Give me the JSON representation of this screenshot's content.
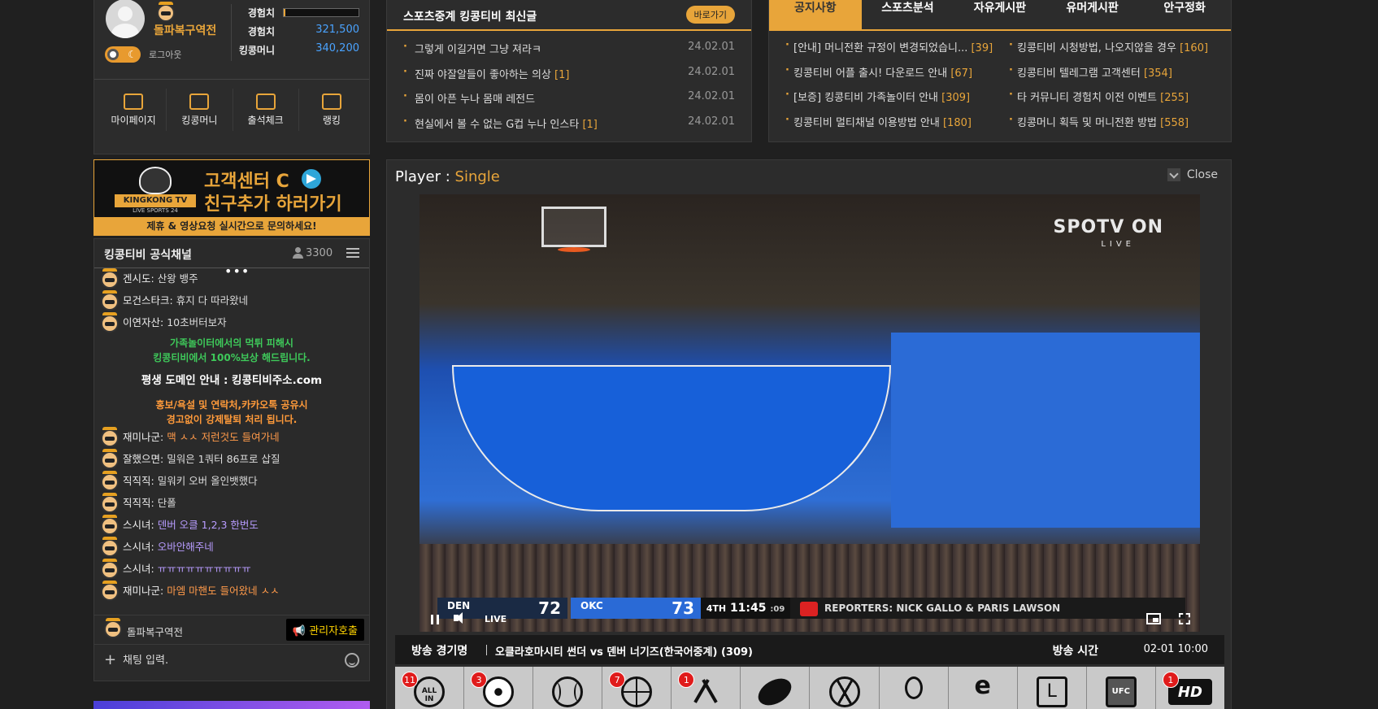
{
  "profile": {
    "username": "돌파복구역전",
    "logout_label": "로그아웃",
    "exp_bar_label": "경험치",
    "exp_bar_fraction": 0.02,
    "exp_label": "경험치",
    "exp_value": "321,500",
    "money_label": "킹콩머니",
    "money_value": "340,200",
    "theme_moon": "☾",
    "quick_menu": [
      {
        "label": "마이페이지",
        "icon": "id-card-icon"
      },
      {
        "label": "킹콩머니",
        "icon": "wallet-icon"
      },
      {
        "label": "출석체크",
        "icon": "envelope-check-icon"
      },
      {
        "label": "랭킹",
        "icon": "podium-icon"
      }
    ]
  },
  "board": {
    "title": "스포츠중계 킹콩티비 최신글",
    "goto_label": "바로가기",
    "posts": [
      {
        "title": "그렇게 이길거면 그냥 져라ㅋ",
        "count": "",
        "date": "24.02.01"
      },
      {
        "title": "진짜 야잘알들이 좋아하는 의상",
        "count": "[1]",
        "date": "24.02.01"
      },
      {
        "title": "몸이 아픈 누나 몸매 레전드",
        "count": "",
        "date": "24.02.01"
      },
      {
        "title": "현실에서 볼 수 없는 G컵 누나 인스타",
        "count": "[1]",
        "date": "24.02.01"
      }
    ]
  },
  "notice": {
    "tabs": [
      "공지사항",
      "스포츠분석",
      "자유게시판",
      "유머게시판",
      "안구정화"
    ],
    "active_tab": 0,
    "items": [
      {
        "title": "[안내] 머니전환 규정이 변경되었습니...",
        "count": "[39]"
      },
      {
        "title": "킹콩티비 시청방법, 나오지않을 경우",
        "count": "[160]"
      },
      {
        "title": "킹콩티비 어플 출시! 다운로드 안내",
        "count": "[67]"
      },
      {
        "title": "킹콩티비 텔레그램 고객센터",
        "count": "[354]"
      },
      {
        "title": "[보증] 킹콩티비 가족놀이터 안내",
        "count": "[309]"
      },
      {
        "title": "타 커뮤니티 경험치 이전 이벤트",
        "count": "[255]"
      },
      {
        "title": "킹콩티비 멀티채널 이용방법 안내",
        "count": "[180]"
      },
      {
        "title": "킹콩머니 획득 및 머니전환 방법",
        "count": "[558]"
      }
    ]
  },
  "banner": {
    "logo_name": "KINGKONG TV",
    "logo_sub": "LIVE SPORTS 24",
    "line1": "고객센터 C",
    "line2": "친구추가 하러가기",
    "strip": "제휴 & 영상요청 실시간으로 문의하세요!"
  },
  "chat": {
    "title": "킹콩티비 공식채널",
    "viewer_count": "3300",
    "dots": "•••",
    "messages_top": [
      {
        "nick": "겐시도:",
        "text": "산왕 뱅주",
        "style": ""
      },
      {
        "nick": "모건스타크:",
        "text": "휴지 다 따라왔네",
        "style": ""
      },
      {
        "nick": "이연자산:",
        "text": "10초버터보자",
        "style": ""
      }
    ],
    "system_green": [
      "가족놀이터에서의 먹튀 피해시",
      "킹콩티비에서 100%보상 해드립니다."
    ],
    "system_white": "평생 도메인 안내 : 킹콩티비주소.com",
    "system_orange": [
      "홍보/욕설 및 연락처,카카오톡 공유시",
      "경고없이 강제탈퇴 처리 됩니다."
    ],
    "messages_bottom": [
      {
        "nick": "재미나군:",
        "text": "맥 ㅅㅅ 저런것도 들여가네",
        "style": "orange"
      },
      {
        "nick": "잘했으면:",
        "text": "밀워은 1쿼터 86프로 삽질",
        "style": ""
      },
      {
        "nick": "직직직:",
        "text": "밀워키 오버 올인뱃했다",
        "style": ""
      },
      {
        "nick": "직직직:",
        "text": "단폴",
        "style": ""
      },
      {
        "nick": "스시녀:",
        "text": "덴버 오클 1,2,3 한번도",
        "style": "purple"
      },
      {
        "nick": "스시녀:",
        "text": "오바안해주네",
        "style": "purple"
      },
      {
        "nick": "스시녀:",
        "text": "ㅠㅠㅠㅠㅠㅠㅠㅠㅠㅠ",
        "style": "purple"
      },
      {
        "nick": "재미나군:",
        "text": "마엠 마핸도 들어왔네 ㅅㅅ",
        "style": "orange"
      }
    ],
    "current_user": "돌파복구역전",
    "call_admin_label": "관리자호출",
    "input_placeholder": "채팅 입력.",
    "plus": "+"
  },
  "player": {
    "title_prefix": "Player :",
    "mode": "Single",
    "close_label": "Close",
    "overlay_brand": "SPOTV ON",
    "overlay_live": "LIVE",
    "scorebug": {
      "team1_name": "DEN",
      "team1_score": "72",
      "team2_name": "OKC",
      "team2_score": "73",
      "quarter": "4TH",
      "clock": "11:45",
      "shot_clock": ":09",
      "reporters": "REPORTERS: NICK GALLO & PARIS LAWSON"
    },
    "live_label": "LIVE",
    "match_label": "방송 경기명",
    "match_name": "오클라호마시티 썬더 vs 덴버 너기즈(한국어중계) (309)",
    "time_label": "방송 시간",
    "time_value": "02-01 10:00",
    "sports": [
      {
        "name": "all",
        "badge": "11"
      },
      {
        "name": "soccer",
        "badge": "3"
      },
      {
        "name": "baseball",
        "badge": ""
      },
      {
        "name": "basketball",
        "badge": "7"
      },
      {
        "name": "hockey",
        "badge": "1"
      },
      {
        "name": "football",
        "badge": ""
      },
      {
        "name": "volleyball",
        "badge": ""
      },
      {
        "name": "tennis",
        "badge": ""
      },
      {
        "name": "esports",
        "badge": ""
      },
      {
        "name": "lol",
        "badge": ""
      },
      {
        "name": "ufc",
        "badge": ""
      },
      {
        "name": "hd",
        "badge": "1"
      }
    ]
  },
  "colors": {
    "accent": "#e8a53a",
    "link_blue": "#4aa3ff",
    "badge_red": "#e01b1b"
  }
}
